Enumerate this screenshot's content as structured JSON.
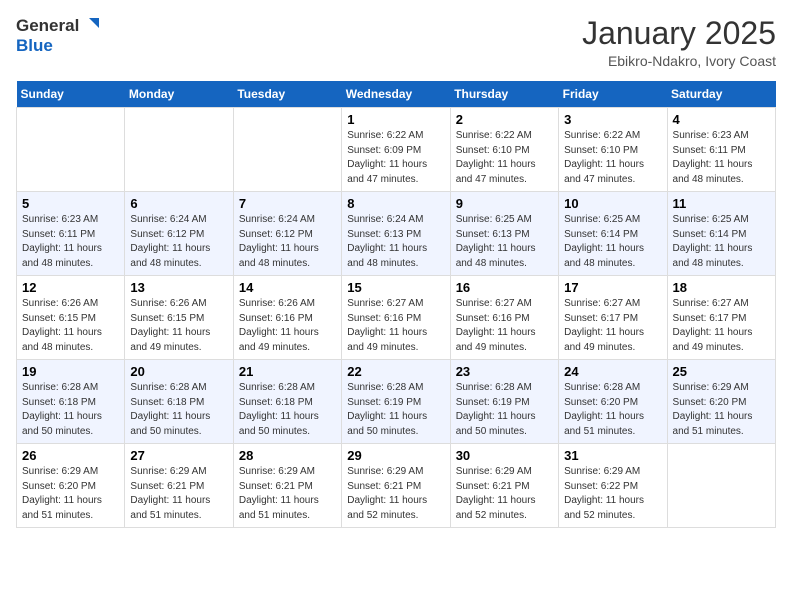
{
  "header": {
    "logo_general": "General",
    "logo_blue": "Blue",
    "title": "January 2025",
    "subtitle": "Ebikro-Ndakro, Ivory Coast"
  },
  "days_of_week": [
    "Sunday",
    "Monday",
    "Tuesday",
    "Wednesday",
    "Thursday",
    "Friday",
    "Saturday"
  ],
  "weeks": [
    [
      {
        "day": "",
        "sunrise": "",
        "sunset": "",
        "daylight": ""
      },
      {
        "day": "",
        "sunrise": "",
        "sunset": "",
        "daylight": ""
      },
      {
        "day": "",
        "sunrise": "",
        "sunset": "",
        "daylight": ""
      },
      {
        "day": "1",
        "sunrise": "Sunrise: 6:22 AM",
        "sunset": "Sunset: 6:09 PM",
        "daylight": "Daylight: 11 hours and 47 minutes."
      },
      {
        "day": "2",
        "sunrise": "Sunrise: 6:22 AM",
        "sunset": "Sunset: 6:10 PM",
        "daylight": "Daylight: 11 hours and 47 minutes."
      },
      {
        "day": "3",
        "sunrise": "Sunrise: 6:22 AM",
        "sunset": "Sunset: 6:10 PM",
        "daylight": "Daylight: 11 hours and 47 minutes."
      },
      {
        "day": "4",
        "sunrise": "Sunrise: 6:23 AM",
        "sunset": "Sunset: 6:11 PM",
        "daylight": "Daylight: 11 hours and 48 minutes."
      }
    ],
    [
      {
        "day": "5",
        "sunrise": "Sunrise: 6:23 AM",
        "sunset": "Sunset: 6:11 PM",
        "daylight": "Daylight: 11 hours and 48 minutes."
      },
      {
        "day": "6",
        "sunrise": "Sunrise: 6:24 AM",
        "sunset": "Sunset: 6:12 PM",
        "daylight": "Daylight: 11 hours and 48 minutes."
      },
      {
        "day": "7",
        "sunrise": "Sunrise: 6:24 AM",
        "sunset": "Sunset: 6:12 PM",
        "daylight": "Daylight: 11 hours and 48 minutes."
      },
      {
        "day": "8",
        "sunrise": "Sunrise: 6:24 AM",
        "sunset": "Sunset: 6:13 PM",
        "daylight": "Daylight: 11 hours and 48 minutes."
      },
      {
        "day": "9",
        "sunrise": "Sunrise: 6:25 AM",
        "sunset": "Sunset: 6:13 PM",
        "daylight": "Daylight: 11 hours and 48 minutes."
      },
      {
        "day": "10",
        "sunrise": "Sunrise: 6:25 AM",
        "sunset": "Sunset: 6:14 PM",
        "daylight": "Daylight: 11 hours and 48 minutes."
      },
      {
        "day": "11",
        "sunrise": "Sunrise: 6:25 AM",
        "sunset": "Sunset: 6:14 PM",
        "daylight": "Daylight: 11 hours and 48 minutes."
      }
    ],
    [
      {
        "day": "12",
        "sunrise": "Sunrise: 6:26 AM",
        "sunset": "Sunset: 6:15 PM",
        "daylight": "Daylight: 11 hours and 48 minutes."
      },
      {
        "day": "13",
        "sunrise": "Sunrise: 6:26 AM",
        "sunset": "Sunset: 6:15 PM",
        "daylight": "Daylight: 11 hours and 49 minutes."
      },
      {
        "day": "14",
        "sunrise": "Sunrise: 6:26 AM",
        "sunset": "Sunset: 6:16 PM",
        "daylight": "Daylight: 11 hours and 49 minutes."
      },
      {
        "day": "15",
        "sunrise": "Sunrise: 6:27 AM",
        "sunset": "Sunset: 6:16 PM",
        "daylight": "Daylight: 11 hours and 49 minutes."
      },
      {
        "day": "16",
        "sunrise": "Sunrise: 6:27 AM",
        "sunset": "Sunset: 6:16 PM",
        "daylight": "Daylight: 11 hours and 49 minutes."
      },
      {
        "day": "17",
        "sunrise": "Sunrise: 6:27 AM",
        "sunset": "Sunset: 6:17 PM",
        "daylight": "Daylight: 11 hours and 49 minutes."
      },
      {
        "day": "18",
        "sunrise": "Sunrise: 6:27 AM",
        "sunset": "Sunset: 6:17 PM",
        "daylight": "Daylight: 11 hours and 49 minutes."
      }
    ],
    [
      {
        "day": "19",
        "sunrise": "Sunrise: 6:28 AM",
        "sunset": "Sunset: 6:18 PM",
        "daylight": "Daylight: 11 hours and 50 minutes."
      },
      {
        "day": "20",
        "sunrise": "Sunrise: 6:28 AM",
        "sunset": "Sunset: 6:18 PM",
        "daylight": "Daylight: 11 hours and 50 minutes."
      },
      {
        "day": "21",
        "sunrise": "Sunrise: 6:28 AM",
        "sunset": "Sunset: 6:18 PM",
        "daylight": "Daylight: 11 hours and 50 minutes."
      },
      {
        "day": "22",
        "sunrise": "Sunrise: 6:28 AM",
        "sunset": "Sunset: 6:19 PM",
        "daylight": "Daylight: 11 hours and 50 minutes."
      },
      {
        "day": "23",
        "sunrise": "Sunrise: 6:28 AM",
        "sunset": "Sunset: 6:19 PM",
        "daylight": "Daylight: 11 hours and 50 minutes."
      },
      {
        "day": "24",
        "sunrise": "Sunrise: 6:28 AM",
        "sunset": "Sunset: 6:20 PM",
        "daylight": "Daylight: 11 hours and 51 minutes."
      },
      {
        "day": "25",
        "sunrise": "Sunrise: 6:29 AM",
        "sunset": "Sunset: 6:20 PM",
        "daylight": "Daylight: 11 hours and 51 minutes."
      }
    ],
    [
      {
        "day": "26",
        "sunrise": "Sunrise: 6:29 AM",
        "sunset": "Sunset: 6:20 PM",
        "daylight": "Daylight: 11 hours and 51 minutes."
      },
      {
        "day": "27",
        "sunrise": "Sunrise: 6:29 AM",
        "sunset": "Sunset: 6:21 PM",
        "daylight": "Daylight: 11 hours and 51 minutes."
      },
      {
        "day": "28",
        "sunrise": "Sunrise: 6:29 AM",
        "sunset": "Sunset: 6:21 PM",
        "daylight": "Daylight: 11 hours and 51 minutes."
      },
      {
        "day": "29",
        "sunrise": "Sunrise: 6:29 AM",
        "sunset": "Sunset: 6:21 PM",
        "daylight": "Daylight: 11 hours and 52 minutes."
      },
      {
        "day": "30",
        "sunrise": "Sunrise: 6:29 AM",
        "sunset": "Sunset: 6:21 PM",
        "daylight": "Daylight: 11 hours and 52 minutes."
      },
      {
        "day": "31",
        "sunrise": "Sunrise: 6:29 AM",
        "sunset": "Sunset: 6:22 PM",
        "daylight": "Daylight: 11 hours and 52 minutes."
      },
      {
        "day": "",
        "sunrise": "",
        "sunset": "",
        "daylight": ""
      }
    ]
  ]
}
